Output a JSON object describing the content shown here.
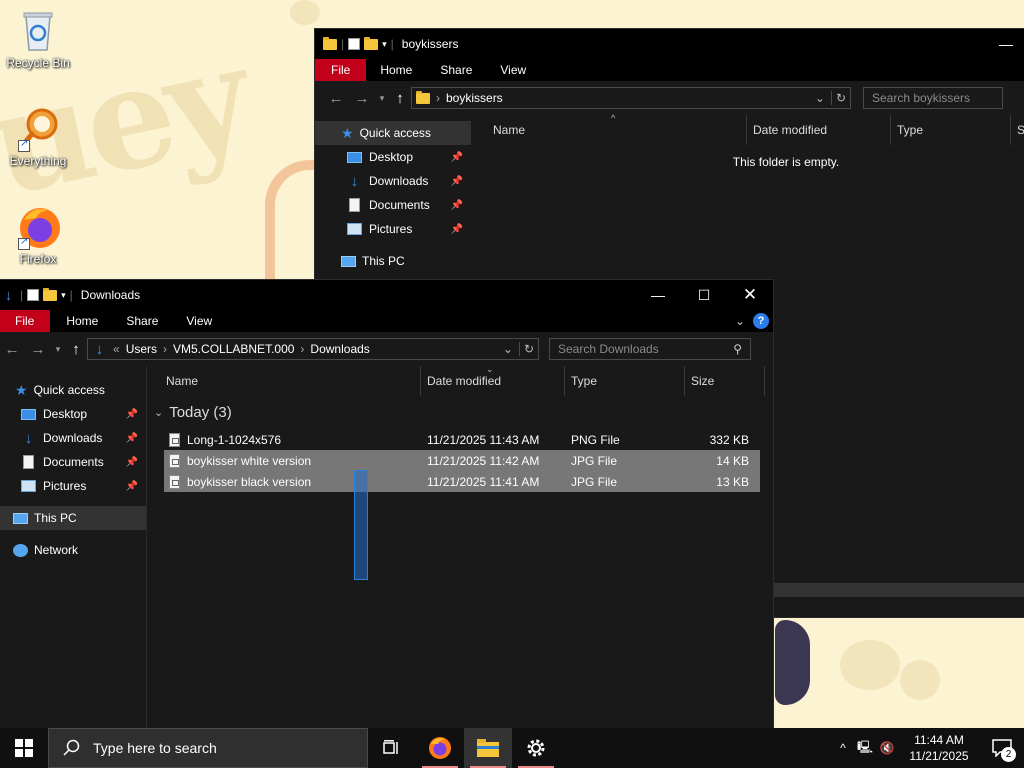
{
  "desktop": {
    "icons": [
      {
        "label": "Recycle Bin",
        "icon": "recycle-bin-icon"
      },
      {
        "label": "Everything",
        "icon": "everything-search-icon"
      },
      {
        "label": "Firefox",
        "icon": "firefox-icon"
      }
    ]
  },
  "back_window": {
    "title": "boykissers",
    "ribbon": {
      "file": "File",
      "home": "Home",
      "share": "Share",
      "view": "View"
    },
    "address": {
      "folder": "boykissers"
    },
    "search": {
      "placeholder": "Search boykissers"
    },
    "nav": {
      "quick_access": "Quick access",
      "items": [
        {
          "label": "Desktop",
          "pinned": true
        },
        {
          "label": "Downloads",
          "pinned": true
        },
        {
          "label": "Documents",
          "pinned": true
        },
        {
          "label": "Pictures",
          "pinned": true
        }
      ],
      "this_pc": "This PC"
    },
    "columns": {
      "name": "Name",
      "date": "Date modified",
      "type": "Type",
      "size": "S"
    },
    "empty_message": "This folder is empty."
  },
  "front_window": {
    "title": "Downloads",
    "ribbon": {
      "file": "File",
      "home": "Home",
      "share": "Share",
      "view": "View"
    },
    "address": {
      "overflow": "«",
      "crumbs": [
        "Users",
        "VM5.COLLABNET.000",
        "Downloads"
      ]
    },
    "search": {
      "placeholder": "Search Downloads"
    },
    "nav": {
      "quick_access": "Quick access",
      "items": [
        {
          "label": "Desktop",
          "pinned": true
        },
        {
          "label": "Downloads",
          "pinned": true
        },
        {
          "label": "Documents",
          "pinned": true
        },
        {
          "label": "Pictures",
          "pinned": true
        }
      ],
      "this_pc": "This PC",
      "network": "Network"
    },
    "columns": {
      "name": "Name",
      "date": "Date modified",
      "type": "Type",
      "size": "Size"
    },
    "group": {
      "label": "Today (3)"
    },
    "files": [
      {
        "name": "Long-1-1024x576",
        "date": "11/21/2025 11:43 AM",
        "type": "PNG File",
        "size": "332 KB",
        "selected": false
      },
      {
        "name": "boykisser white version",
        "date": "11/21/2025 11:42 AM",
        "type": "JPG File",
        "size": "14 KB",
        "selected": true
      },
      {
        "name": "boykisser black version",
        "date": "11/21/2025 11:41 AM",
        "type": "JPG File",
        "size": "13 KB",
        "selected": true
      }
    ]
  },
  "taskbar": {
    "search_placeholder": "Type here to search",
    "apps": [
      "task-view-icon",
      "firefox-icon",
      "file-explorer-icon",
      "settings-icon"
    ],
    "clock": {
      "time": "11:44 AM",
      "date": "11/21/2025"
    },
    "notifications": "2"
  },
  "colors": {
    "file_tab": "#c3001a",
    "selection": "#777777",
    "accent": "#3a8ee6"
  }
}
